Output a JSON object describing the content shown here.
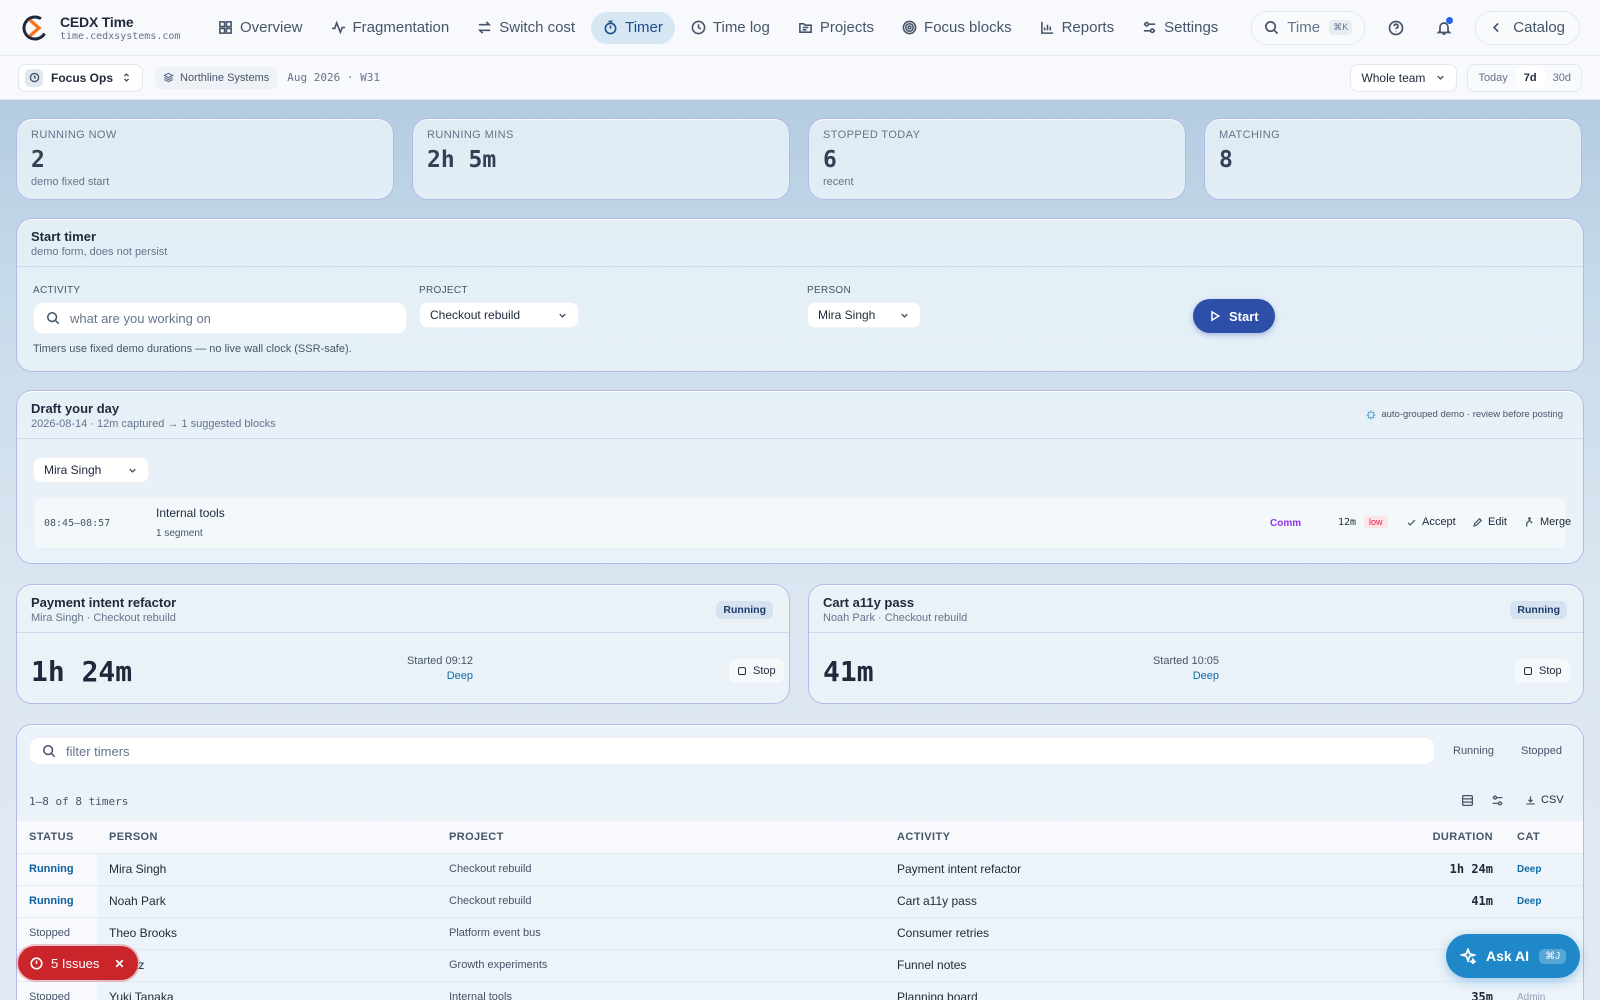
{
  "brand": {
    "title": "CEDX Time",
    "subtitle": "time.cedxsystems.com"
  },
  "nav": [
    {
      "label": "Overview",
      "icon": "grid-icon"
    },
    {
      "label": "Fragmentation",
      "icon": "activity-icon"
    },
    {
      "label": "Switch cost",
      "icon": "switch-icon"
    },
    {
      "label": "Timer",
      "icon": "timer-icon",
      "active": true
    },
    {
      "label": "Time log",
      "icon": "clock-icon"
    },
    {
      "label": "Projects",
      "icon": "folder-icon"
    },
    {
      "label": "Focus blocks",
      "icon": "target-icon"
    },
    {
      "label": "Reports",
      "icon": "bar-chart-icon"
    },
    {
      "label": "Settings",
      "icon": "sliders-icon"
    }
  ],
  "topright": {
    "search_label": "Time",
    "search_kbd": "⌘K",
    "catalog_label": "Catalog"
  },
  "subbar": {
    "workspace": "Focus Ops",
    "org": "Northline Systems",
    "period": "Aug 2026 · W31",
    "team": "Whole team",
    "ranges": [
      "Today",
      "7d",
      "30d"
    ],
    "active_range": "7d"
  },
  "stats": [
    {
      "label": "Running now",
      "value": "2",
      "sub": "demo fixed start"
    },
    {
      "label": "Running mins",
      "value": "2h 5m",
      "sub": ""
    },
    {
      "label": "Stopped today",
      "value": "6",
      "sub": "recent"
    },
    {
      "label": "Matching",
      "value": "8",
      "sub": ""
    }
  ],
  "start_timer": {
    "title": "Start timer",
    "subtitle": "demo form, does not persist",
    "activity_label": "Activity",
    "activity_placeholder": "what are you working on",
    "project_label": "Project",
    "project_value": "Checkout rebuild",
    "person_label": "Person",
    "person_value": "Mira Singh",
    "start_label": "Start",
    "note": "Timers use fixed demo durations — no live wall clock (SSR-safe)."
  },
  "draft": {
    "title": "Draft your day",
    "subtitle": "2026-08-14 · 12m captured → 1 suggested blocks",
    "hint": "auto-grouped demo · review before posting",
    "person": "Mira Singh",
    "block": {
      "time": "08:45–08:57",
      "name": "Internal tools",
      "segments": "1 segment",
      "cat": "Comm",
      "dur": "12m",
      "confidence": "low",
      "accept": "Accept",
      "edit": "Edit",
      "merge": "Merge"
    }
  },
  "running": [
    {
      "title": "Payment intent refactor",
      "sub": "Mira Singh · Checkout rebuild",
      "status": "Running",
      "elapsed": "1h 24m",
      "started": "Started 09:12",
      "cat": "Deep",
      "stop": "Stop"
    },
    {
      "title": "Cart a11y pass",
      "sub": "Noah Park · Checkout rebuild",
      "status": "Running",
      "elapsed": "41m",
      "started": "Started 10:05",
      "cat": "Deep",
      "stop": "Stop"
    }
  ],
  "list": {
    "filter_placeholder": "filter timers",
    "tabs": [
      "Running",
      "Stopped"
    ],
    "count": "1–8 of 8 timers",
    "csv": "CSV",
    "headers": {
      "status": "Status",
      "person": "Person",
      "project": "Project",
      "activity": "Activity",
      "duration": "Duration",
      "cat": "Cat"
    },
    "rows": [
      {
        "status": "Running",
        "person": "Mira Singh",
        "project": "Checkout rebuild",
        "activity": "Payment intent refactor",
        "duration": "1h 24m",
        "cat": "Deep"
      },
      {
        "status": "Running",
        "person": "Noah Park",
        "project": "Checkout rebuild",
        "activity": "Cart a11y pass",
        "duration": "41m",
        "cat": "Deep"
      },
      {
        "status": "Stopped",
        "person": "Theo Brooks",
        "project": "Platform event bus",
        "activity": "Consumer retries",
        "duration": "",
        "cat": ""
      },
      {
        "status": "",
        "person": "a Ortiz",
        "project": "Growth experiments",
        "activity": "Funnel notes",
        "duration": "",
        "cat": ""
      },
      {
        "status": "Stopped",
        "person": "Yuki Tanaka",
        "project": "Internal tools",
        "activity": "Planning board",
        "duration": "35m",
        "cat": "Admin"
      }
    ]
  },
  "issues": {
    "label": "5 Issues"
  },
  "askai": {
    "label": "Ask AI",
    "kbd": "⌘J"
  },
  "colors": {
    "accent": "#2e4fa8",
    "running": "#0e5f9f",
    "issues": "#c9252b",
    "askai": "#1f88c9",
    "low": "#e11d48",
    "comm": "#9333ea"
  }
}
